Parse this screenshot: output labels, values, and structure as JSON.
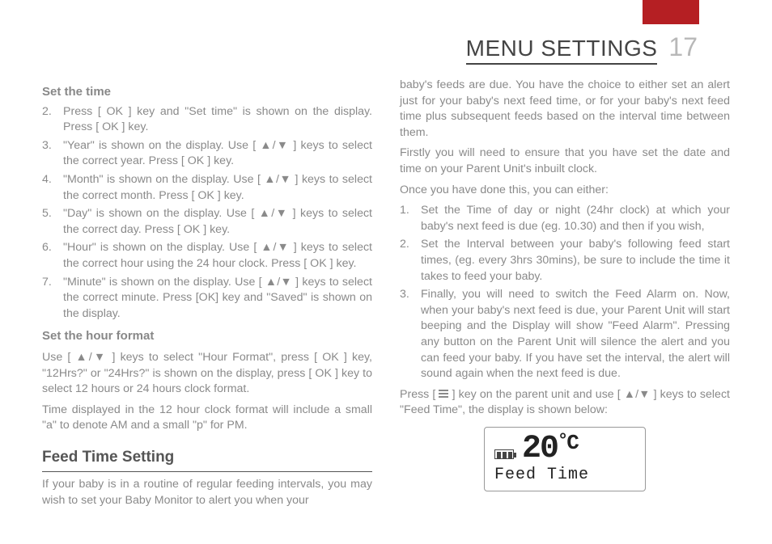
{
  "header": {
    "title": "MENU SETTINGS",
    "page": "17"
  },
  "icons": {
    "updown": "▲/▼"
  },
  "col1": {
    "h_settime": "Set the time",
    "steps_time": [
      {
        "n": "2.",
        "t": "Press [ OK ] key and \"Set time\" is shown on the display. Press [ OK ] key."
      },
      {
        "n": "3.",
        "t": "\"Year\" is shown on the display. Use [ ▲/▼ ] keys to select the correct year. Press [ OK ] key."
      },
      {
        "n": "4.",
        "t": "\"Month\" is shown on the display. Use [ ▲/▼ ] keys to select the correct month. Press [ OK ] key."
      },
      {
        "n": "5.",
        "t": "\"Day\" is shown on the display. Use [ ▲/▼ ] keys to select the correct day. Press [ OK ] key."
      },
      {
        "n": "6.",
        "t": "\"Hour\" is shown on the display. Use [ ▲/▼ ] keys to select the correct hour using the 24 hour clock. Press [ OK ] key."
      },
      {
        "n": "7.",
        "t": "\"Minute\" is shown on the display. Use [ ▲/▼ ] keys to select the correct minute. Press [OK] key and \"Saved\" is shown on the display."
      }
    ],
    "h_hourfmt": "Set the hour format",
    "p_hourfmt1": "Use [ ▲/▼ ] keys to select \"Hour Format\", press [ OK ] key, \"12Hrs?\" or \"24Hrs?\" is shown on the display, press [ OK ] key to select 12 hours or 24 hours clock format.",
    "p_hourfmt2": "Time displayed in the 12 hour clock format will include a small \"a\" to denote AM and a small \"p\" for PM.",
    "h_feed": "Feed Time Setting",
    "p_feed_intro": "If your baby is in a routine of regular feeding intervals, you may wish to set your Baby Monitor to alert you when your"
  },
  "col2": {
    "p_cont": "baby's feeds are due. You have the choice to either set an alert just for your baby's next feed time, or for your baby's next feed time plus subsequent feeds based on the interval time between them.",
    "p_first": "Firstly you will need to ensure that you have set the date and time on your Parent Unit's inbuilt clock.",
    "p_once": "Once you have done this, you can either:",
    "steps_feed": [
      {
        "n": "1.",
        "t": "Set the Time of day or night (24hr clock) at which your baby's next feed is due (eg. 10.30) and then if you wish,"
      },
      {
        "n": "2.",
        "t": "Set the Interval between your baby's following feed start times, (eg. every 3hrs 30mins), be sure to include the time it takes to feed your baby."
      },
      {
        "n": "3.",
        "t": "Finally, you will need to switch the Feed Alarm on. Now, when your baby's next feed is due, your Parent Unit will start beeping and the Display will show \"Feed Alarm\". Pressing any button on the Parent Unit will silence the alert and you can feed your baby. If you have set the interval, the alert will sound again when the next feed is due."
      }
    ],
    "p_press_a": "Press [ ",
    "p_press_b": " ] key on the parent unit and use [ ▲/▼ ] keys to select \"Feed Time\", the display is shown below:"
  },
  "lcd": {
    "temp": "20",
    "unit": "℃",
    "label": "Feed Time"
  }
}
